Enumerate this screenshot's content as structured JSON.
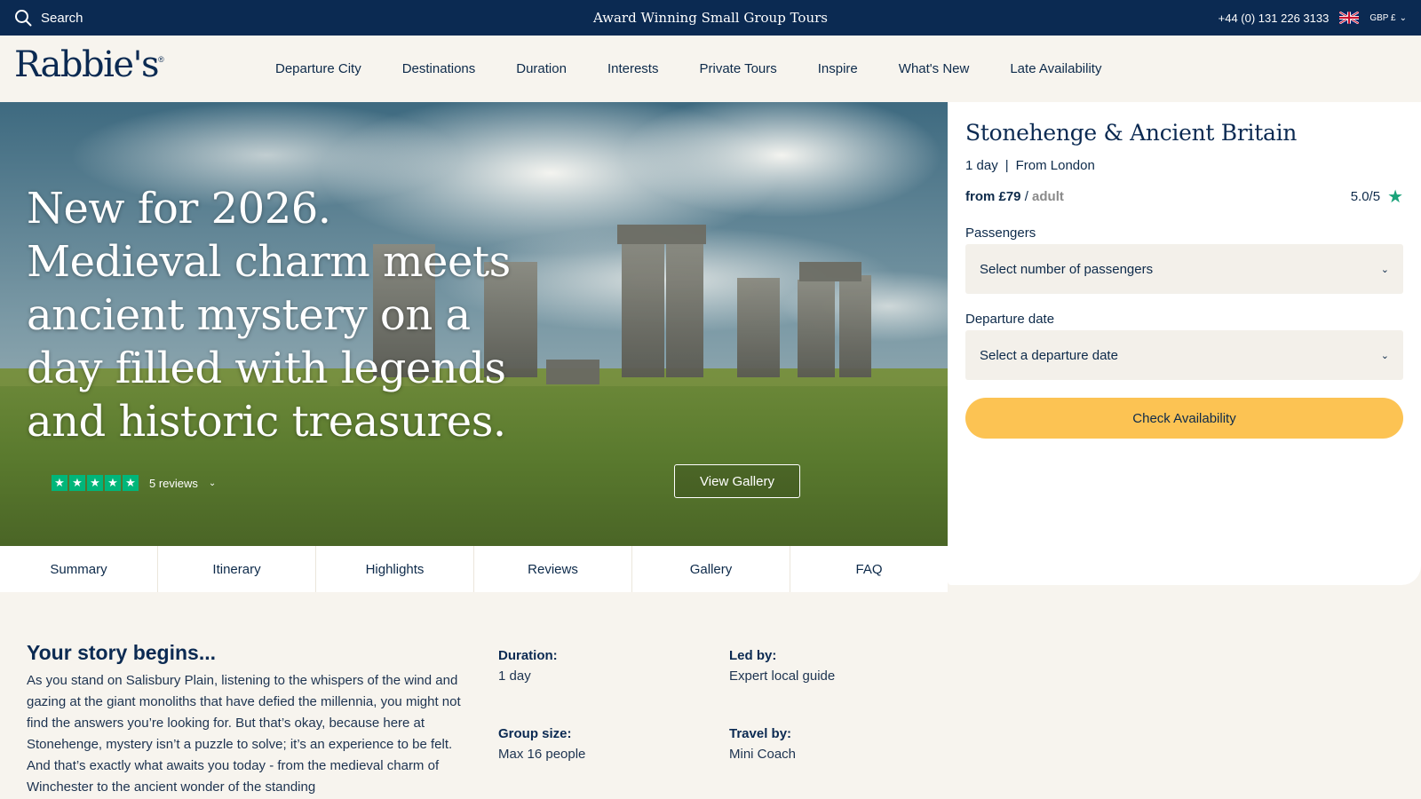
{
  "topbar": {
    "search_label": "Search",
    "tagline": "Award Winning Small Group Tours",
    "phone": "+44 (0) 131 226 3133",
    "currency": "GBP £"
  },
  "brand": {
    "logo_text": "Rabbie's",
    "logo_mark": "®"
  },
  "nav": {
    "items": [
      "Departure City",
      "Destinations",
      "Duration",
      "Interests",
      "Private Tours",
      "Inspire",
      "What's New",
      "Late Availability"
    ]
  },
  "hero": {
    "headline": "New for 2026. Medieval charm meets ancient mystery on a day filled with legends and historic treasures.",
    "reviews_label": "5 reviews",
    "trustpilot_stars": 5,
    "gallery_button": "View Gallery"
  },
  "tabs": [
    "Summary",
    "Itinerary",
    "Highlights",
    "Reviews",
    "Gallery",
    "FAQ"
  ],
  "booking": {
    "title": "Stonehenge & Ancient Britain",
    "duration": "1 day",
    "separator": "|",
    "departure": "From London",
    "price_prefix": "from £79",
    "price_slash": "/",
    "price_unit": "adult",
    "rating": "5.0/5",
    "passengers_label": "Passengers",
    "passengers_placeholder": "Select number of passengers",
    "date_label": "Departure date",
    "date_placeholder": "Select a departure date",
    "cta": "Check Availability"
  },
  "story": {
    "heading": "Your story begins...",
    "body": "As you stand on Salisbury Plain, listening to the whispers of the wind and gazing at the giant monoliths that have defied the millennia, you might not find the answers you’re looking for. But that’s okay, because here at Stonehenge, mystery isn’t a puzzle to solve; it’s an experience to be felt. And that’s exactly what awaits you today - from the medieval charm of Winchester to the ancient wonder of the standing"
  },
  "facts": {
    "duration_label": "Duration:",
    "duration_value": "1 day",
    "led_label": "Led by:",
    "led_value": "Expert local guide",
    "group_label": "Group size:",
    "group_value": "Max 16 people",
    "travel_label": "Travel by:",
    "travel_value": "Mini Coach"
  },
  "colors": {
    "navy": "#0b2a52",
    "cream": "#f7f4ee",
    "cta_yellow": "#fcc353",
    "trustpilot_green": "#00b67a"
  },
  "icons": [
    "search-icon",
    "uk-flag-icon",
    "chevron-down-icon",
    "star-icon"
  ]
}
